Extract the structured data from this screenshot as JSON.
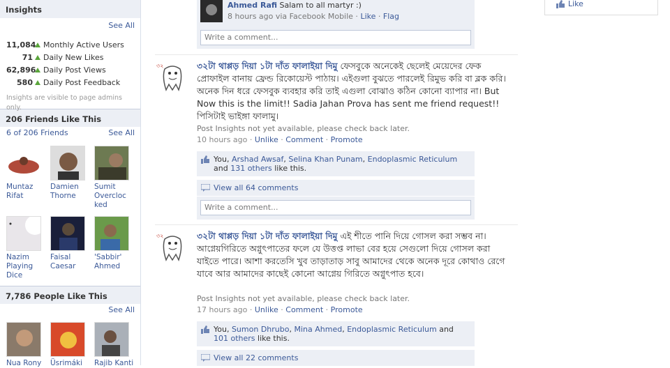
{
  "insights": {
    "title": "Insights",
    "see_all": "See All",
    "stats": [
      {
        "num": "11,084",
        "label": "Monthly Active Users"
      },
      {
        "num": "71",
        "label": "Daily New Likes"
      },
      {
        "num": "62,896",
        "label": "Daily Post Views"
      },
      {
        "num": "580",
        "label": "Daily Post Feedback"
      }
    ],
    "note": "Insights are visible to page admins only."
  },
  "friends_like": {
    "title": "206 Friends Like This",
    "count_link": "6 of 206 Friends",
    "see_all": "See All",
    "people": [
      {
        "name": "Muntaz Rifat"
      },
      {
        "name": "Damien Thorne"
      },
      {
        "name": "Sumit Overcloc ked"
      },
      {
        "name": "Nazim Playing Dice"
      },
      {
        "name": "Faisal Caesar"
      },
      {
        "name": "'Sabbir' Ahmed"
      }
    ]
  },
  "people_like": {
    "title": "7,786 People Like This",
    "see_all": "See All",
    "people": [
      {
        "name": "Nua Rony"
      },
      {
        "name": "Üsrimáki"
      },
      {
        "name": "Rajib Kanti"
      }
    ]
  },
  "right_panel": {
    "like_label": "Like"
  },
  "top_comment": {
    "author": "Ahmed Rafi",
    "text": "Salam to all martyr :)",
    "time": "8 hours ago via Facebook Mobile",
    "like": "Like",
    "flag": "Flag",
    "write_placeholder": "Write a comment..."
  },
  "posts": [
    {
      "author": "৩২টা থাপ্পড় দিয়া ১টা দাঁত ফালাইয়া দিমু",
      "text": "ফেসবুকে অনেকেই ছেলেই মেয়েদের ফেক প্রোফাইল বানায় ফ্রেন্ড রিকোয়েস্ট পাঠায়। এইগুলা বুঝতে পারলেই রিমুভ করি বা ব্লক করি। অনেক দিন ধরে ফেসবুক ব্যবহার করি তাই এগুলা বোঝাও কঠিন কোনো ব্যাপার না। But Now this is the limit!! Sadia Jahan Prova has sent me friend request!! পিসিটাই ভাইঙ্গা ফালামু।",
      "insights_note": "Post Insights not yet available, please check back later.",
      "time": "10 hours ago",
      "unlike": "Unlike",
      "comment": "Comment",
      "promote": "Promote",
      "likes_prefix": "You, ",
      "likers": [
        "Arshad Awsaf",
        "Selina Khan Punam",
        "Endoplasmic Reticulum"
      ],
      "likes_and": " and ",
      "likes_others": "131 others",
      "likes_suffix": " like this.",
      "view_all": "View all 64 comments",
      "write_placeholder": "Write a comment..."
    },
    {
      "author": "৩২টা থাপ্পড় দিয়া ১টা দাঁত ফালাইয়া দিমু",
      "text": "এই শীতে পানি দিয়ে গোসল করা সম্ভব না। আগ্নেয়গিরিতে অগ্নুৎপাতের ফলে যে উত্তপ্ত লাভা বের হয়ে সেগুলো দিয়ে গোসল করা যাইতে পারে। আশা করতেসি খুব তাড়াতাড় সাবু আমাদের থেকে অনেক দূরে কোথাও রেগে যাবে আর আমাদের কাছেই কোনো আগ্নেয় গিরিতে অগ্নুৎপাত হবে।",
      "insights_note": "Post Insights not yet available, please check back later.",
      "time": "17 hours ago",
      "unlike": "Unlike",
      "comment": "Comment",
      "promote": "Promote",
      "likes_prefix": "You, ",
      "likers": [
        "Sumon Dhrubo",
        "Mina Ahmed",
        "Endoplasmic Reticulum"
      ],
      "likes_and": " and ",
      "likes_others": "101 others",
      "likes_suffix": " like this.",
      "view_all": "View all 22 comments"
    }
  ],
  "colors": {
    "link": "#3b5998",
    "box_bg": "#eceff5",
    "arrow_green": "#5aa53b"
  }
}
